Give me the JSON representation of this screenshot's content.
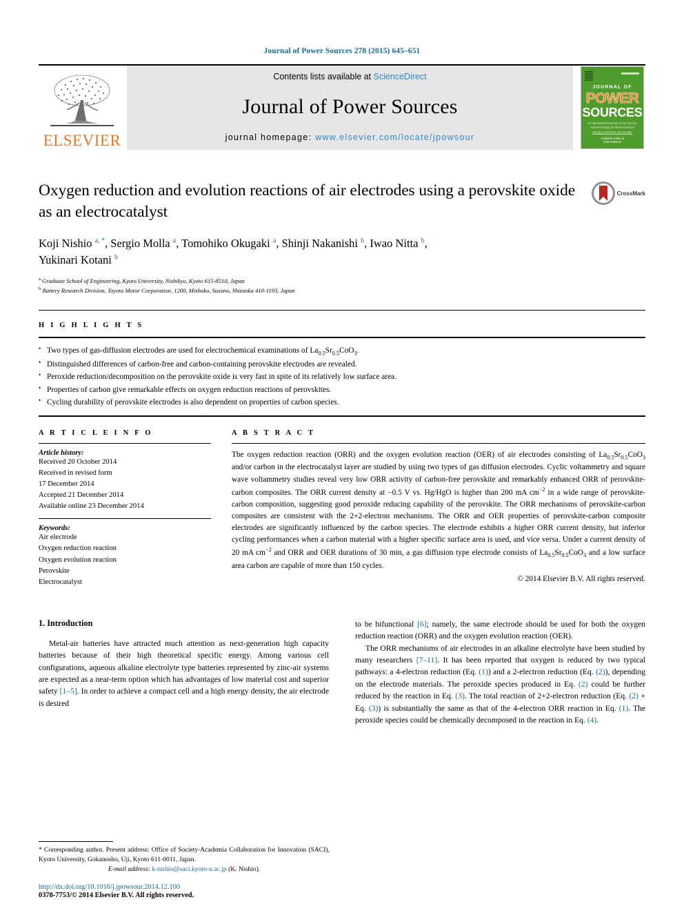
{
  "running_head": "Journal of Power Sources 278 (2015) 645–651",
  "masthead": {
    "publisher_name": "ELSEVIER",
    "contents_prefix": "Contents lists available at ",
    "contents_link": "ScienceDirect",
    "journal_name": "Journal of Power Sources",
    "homepage_prefix": "journal homepage: ",
    "homepage_link": "www.elsevier.com/locate/jpowsour",
    "cover": {
      "journal_of": "JOURNAL OF",
      "power": "POWER",
      "sources": "SOURCES",
      "subtitle": "An international journal on the science and technology of electrochemical energy conversion and storage",
      "footer": "Available online at ScienceDirect"
    }
  },
  "article": {
    "title": "Oxygen reduction and evolution reactions of air electrodes using a perovskite oxide as an electrocatalyst",
    "crossmark_label": "CrossMark",
    "authors": [
      {
        "name": "Koji Nishio",
        "marks": "a, *"
      },
      {
        "name": "Sergio Molla",
        "marks": "a"
      },
      {
        "name": "Tomohiko Okugaki",
        "marks": "a"
      },
      {
        "name": "Shinji Nakanishi",
        "marks": "b"
      },
      {
        "name": "Iwao Nitta",
        "marks": "b"
      },
      {
        "name": "Yukinari Kotani",
        "marks": "b"
      }
    ],
    "affiliations": [
      {
        "mark": "a",
        "text": "Graduate School of Engineering, Kyoto University, Nishikyo, Kyoto 615-8510, Japan"
      },
      {
        "mark": "b",
        "text": "Battery Research Division, Toyota Motor Corporation, 1200, Mishuku, Susono, Shizuoka 410-1193, Japan"
      }
    ]
  },
  "highlights": {
    "label": "H I G H L I G H T S",
    "items": [
      "Two types of gas-diffusion electrodes are used for electrochemical examinations of La0.5Sr0.5CoO3.",
      "Distinguished differences of carbon-free and carbon-containing perovskite electrodes are revealed.",
      "Peroxide reduction/decomposition on the perovskite oxide is very fast in spite of its relatively low surface area.",
      "Properties of carbon give remarkable effects on oxygen reduction reactions of perovskites.",
      "Cycling durability of perovskite electrodes is also dependent on properties of carbon species."
    ]
  },
  "article_info": {
    "label": "A R T I C L E   I N F O",
    "history_label": "Article history:",
    "history": [
      "Received 20 October 2014",
      "Received in revised form",
      "17 December 2014",
      "Accepted 21 December 2014",
      "Available online 23 December 2014"
    ],
    "keywords_label": "Keywords:",
    "keywords": [
      "Air electrode",
      "Oxygen reduction reaction",
      "Oxygen evolution reaction",
      "Perovskite",
      "Electrocatalyst"
    ]
  },
  "abstract": {
    "label": "A B S T R A C T",
    "text": "The oxygen reduction reaction (ORR) and the oxygen evolution reaction (OER) of air electrodes consisting of La0.5Sr0.5CoO3 and/or carbon in the electrocatalyst layer are studied by using two types of gas diffusion electrodes. Cyclic voltammetry and square wave voltammetry studies reveal very low ORR activity of carbon-free perovskite and remarkably enhanced ORR of perovskite-carbon composites. The ORR current density at −0.5 V vs. Hg/HgO is higher than 200 mA cm−2 in a wide range of perovskite-carbon composition, suggesting good peroxide reducing capability of the perovskite. The ORR mechanisms of perovskite-carbon composites are consistent with the 2+2-electron mechanisms. The ORR and OER properties of perovskite-carbon composite electrodes are significantly influenced by the carbon species. The electrode exhibits a higher ORR current density, but inferior cycling performances when a carbon material with a higher specific surface area is used, and vice versa. Under a current density of 20 mA cm−2 and ORR and OER durations of 30 min, a gas diffusion type electrode consists of La0.5Sr0.5CoO3 and a low surface area carbon are capable of more than 150 cycles.",
    "copyright": "© 2014 Elsevier B.V. All rights reserved."
  },
  "body": {
    "section_heading": "1. Introduction",
    "left_paragraph": "Metal-air batteries have attracted much attention as next-generation high capacity batteries because of their high theoretical specific energy. Among various cell configurations, aqueous alkaline electrolyte type batteries represented by zinc-air systems are expected as a near-term option which has advantages of low material cost and superior safety [1–5]. In order to achieve a compact cell and a high energy density, the air electrode is desired",
    "right_paragraph_1": "to be bifunctional [6]; namely, the same electrode should be used for both the oxygen reduction reaction (ORR) and the oxygen evolution reaction (OER).",
    "right_paragraph_2": "The ORR mechanisms of air electrodes in an alkaline electrolyte have been studied by many researchers [7–11]. It has been reported that oxygen is reduced by two typical pathways: a 4-electron reduction (Eq. (1)) and a 2-electron reduction (Eq. (2)), depending on the electrode materials. The peroxide species produced in Eq. (2) could be further reduced by the reaction in Eq. (3). The total reaction of 2+2-electron reduction (Eq. (2) + Eq. (3)) is substantially the same as that of the 4-electron ORR reaction in Eq. (1). The peroxide species could be chemically decomposed in the reaction in Eq. (4)."
  },
  "footnote": {
    "text": "* Corresponding author. Present address: Office of Society-Academia Collaboration for Innovation (SACI), Kyoto University, Gokanosho, Uji, Kyoto 611-0011, Japan.",
    "email_label": "E-mail address:",
    "email": "k-nishio@saci.kyoto-u.ac.jp",
    "email_suffix": "(K. Nishio)."
  },
  "footer": {
    "doi": "http://dx.doi.org/10.1016/j.jpowsour.2014.12.100",
    "issn": "0378-7753/© 2014 Elsevier B.V. All rights reserved."
  },
  "colors": {
    "link_blue": "#1a6c9c",
    "sciencedirect_blue": "#2f88c8",
    "elsevier_orange": "#e87722",
    "cover_green": "#4f9c2d"
  }
}
